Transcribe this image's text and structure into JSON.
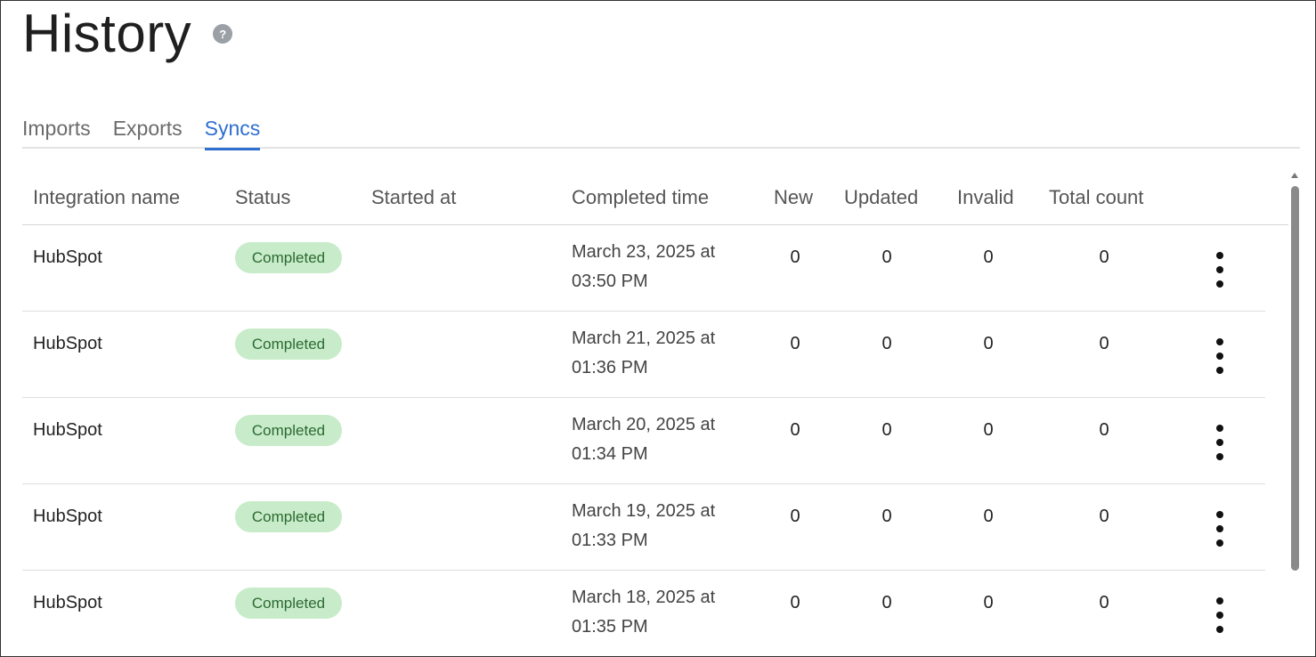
{
  "page": {
    "title": "History",
    "help_icon": "question-mark-icon"
  },
  "tabs": [
    {
      "label": "Imports",
      "active": false
    },
    {
      "label": "Exports",
      "active": false
    },
    {
      "label": "Syncs",
      "active": true
    }
  ],
  "colors": {
    "accent": "#2f6fd1",
    "badge_bg": "#c8ecc9",
    "badge_text": "#2c6a33"
  },
  "table": {
    "columns": {
      "integration_name": "Integration name",
      "status": "Status",
      "started_at": "Started at",
      "completed_time": "Completed time",
      "new": "New",
      "updated": "Updated",
      "invalid": "Invalid",
      "total_count": "Total count"
    },
    "rows": [
      {
        "name": "HubSpot",
        "status": "Completed",
        "started_at": "",
        "completed_line1": "March 23, 2025 at",
        "completed_line2": "03:50 PM",
        "new": "0",
        "updated": "0",
        "invalid": "0",
        "total": "0",
        "menu_icon": "more-vertical-icon"
      },
      {
        "name": "HubSpot",
        "status": "Completed",
        "started_at": "",
        "completed_line1": "March 21, 2025 at",
        "completed_line2": "01:36 PM",
        "new": "0",
        "updated": "0",
        "invalid": "0",
        "total": "0",
        "menu_icon": "more-vertical-icon"
      },
      {
        "name": "HubSpot",
        "status": "Completed",
        "started_at": "",
        "completed_line1": "March 20, 2025 at",
        "completed_line2": "01:34 PM",
        "new": "0",
        "updated": "0",
        "invalid": "0",
        "total": "0",
        "menu_icon": "more-vertical-icon"
      },
      {
        "name": "HubSpot",
        "status": "Completed",
        "started_at": "",
        "completed_line1": "March 19, 2025 at",
        "completed_line2": "01:33 PM",
        "new": "0",
        "updated": "0",
        "invalid": "0",
        "total": "0",
        "menu_icon": "more-vertical-icon"
      },
      {
        "name": "HubSpot",
        "status": "Completed",
        "started_at": "",
        "completed_line1": "March 18, 2025 at",
        "completed_line2": "01:35 PM",
        "new": "0",
        "updated": "0",
        "invalid": "0",
        "total": "0",
        "menu_icon": "more-vertical-icon"
      }
    ]
  }
}
